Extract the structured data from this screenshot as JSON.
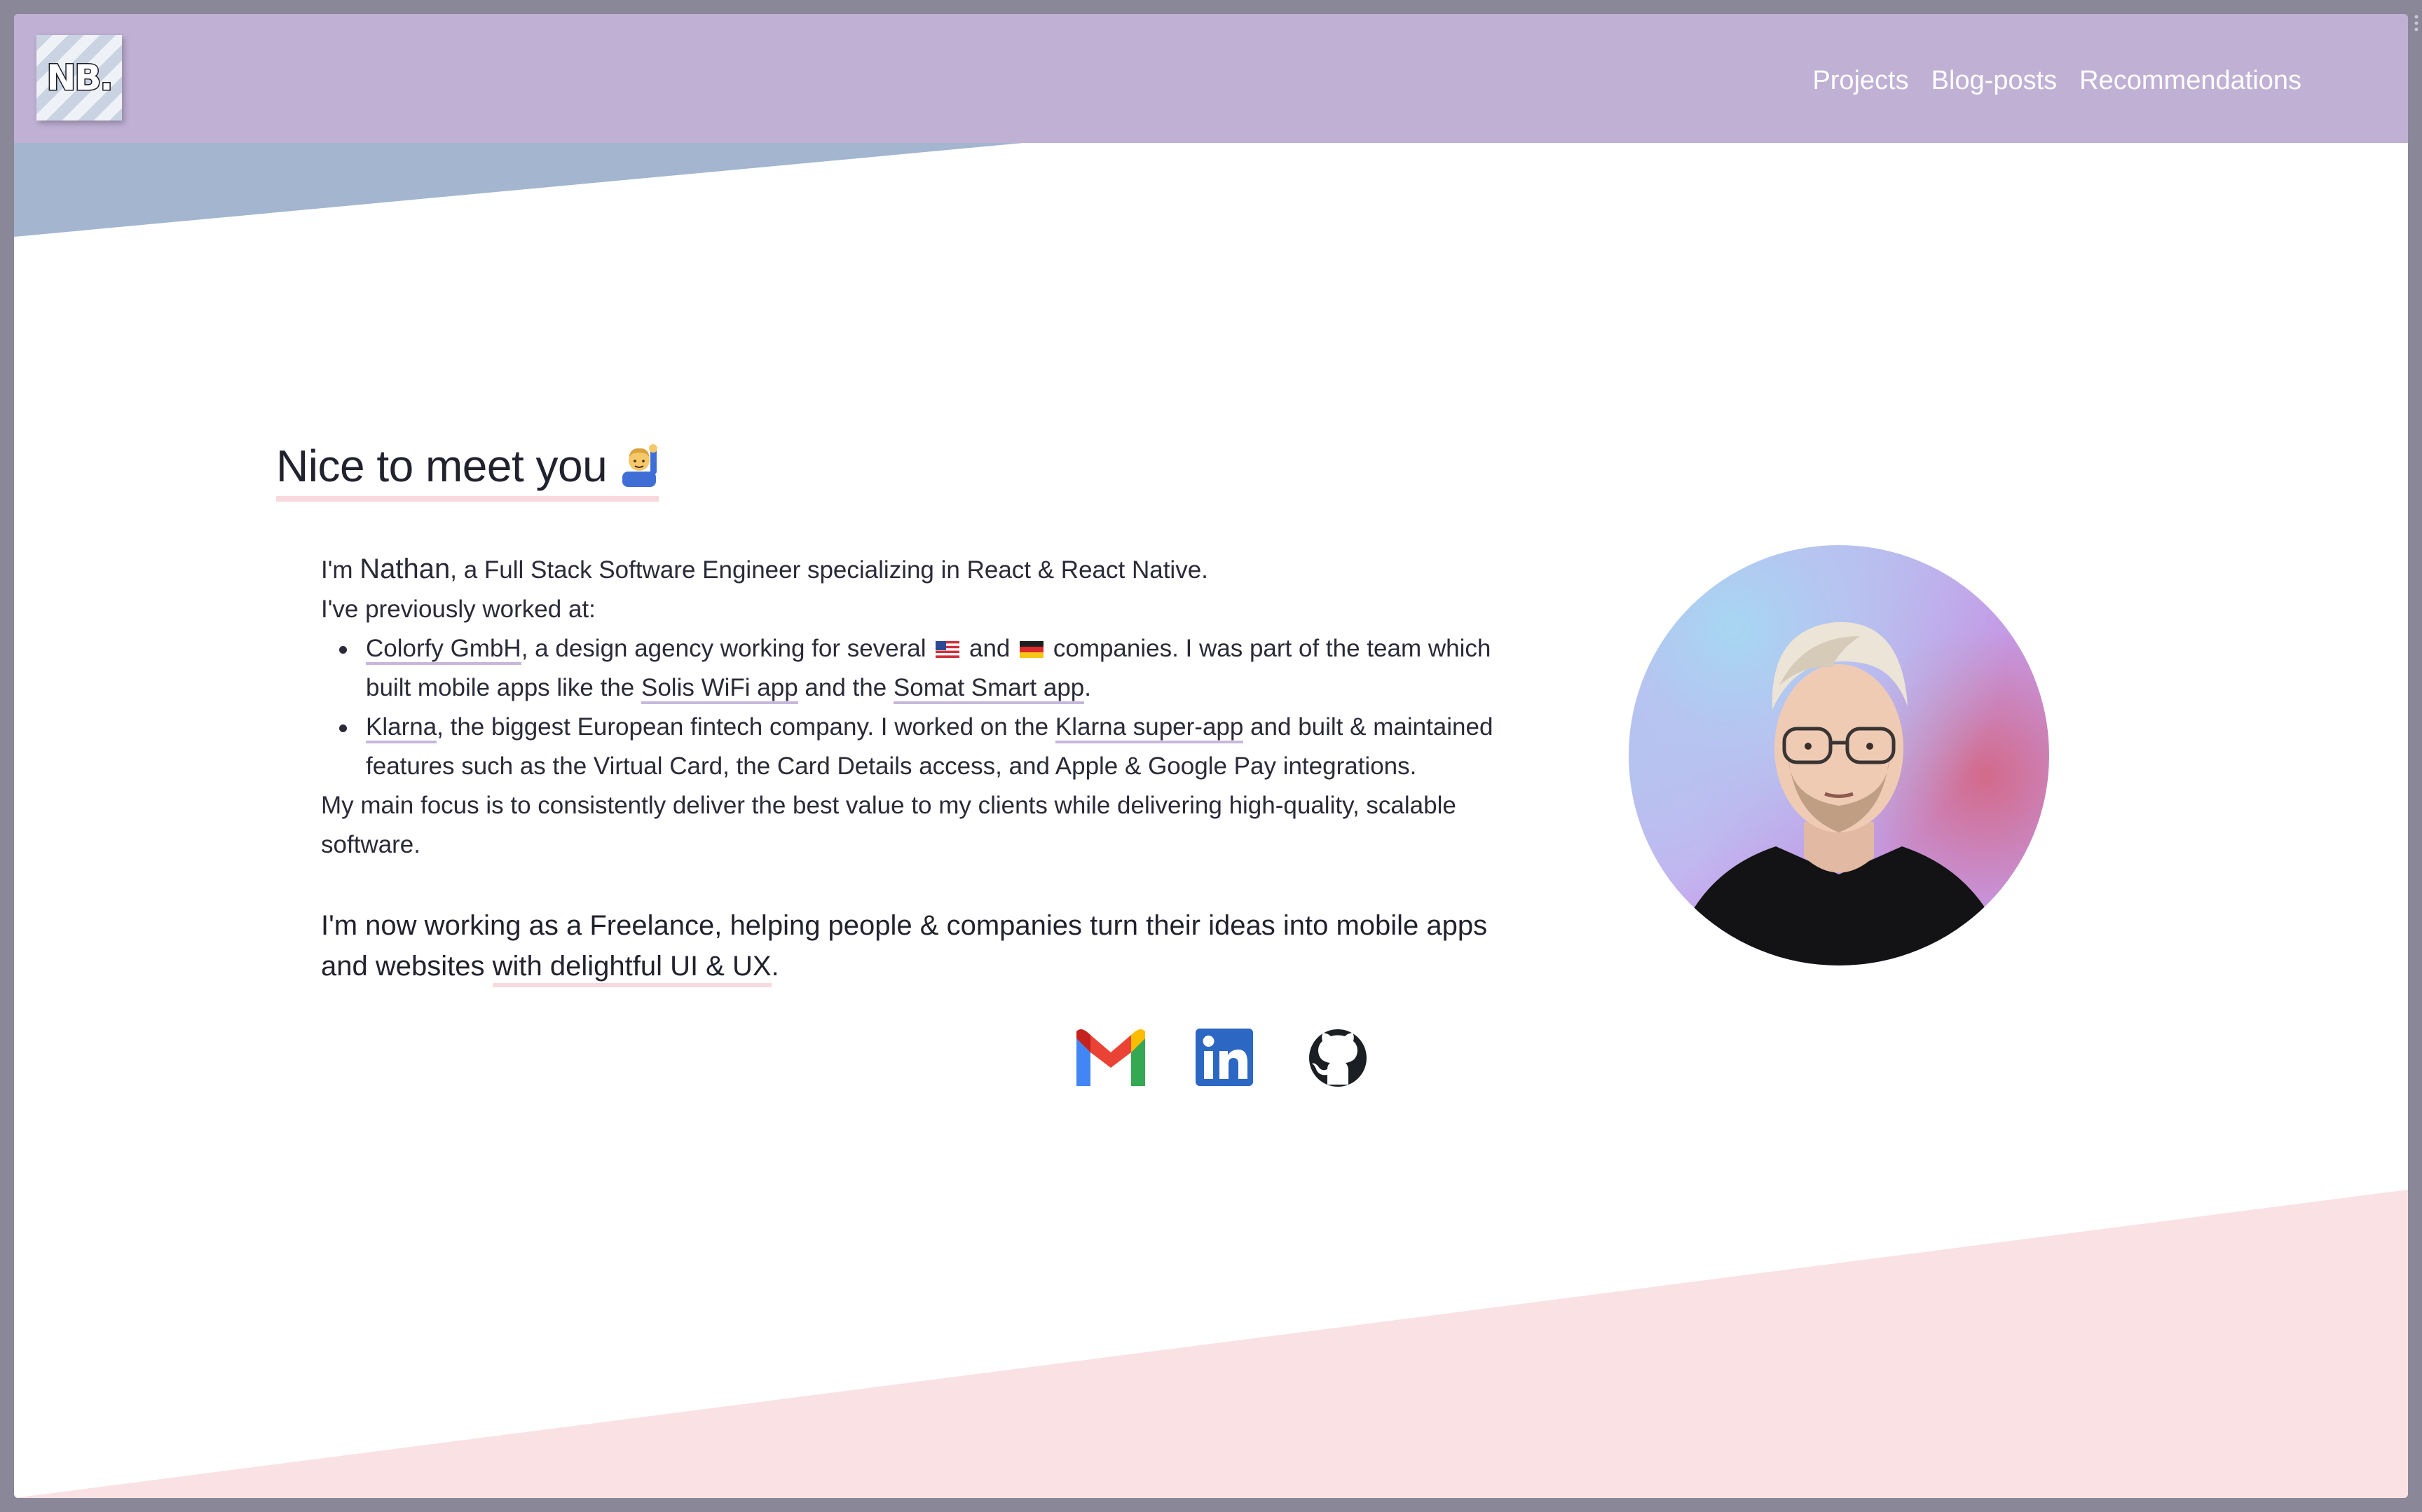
{
  "header": {
    "logo_text": "NB.",
    "nav": [
      "Projects",
      "Blog-posts",
      "Recommendations"
    ]
  },
  "main": {
    "title": "Nice to meet you",
    "title_emoji": "raising-hand-emoji",
    "intro": {
      "line1_prefix": "I'm ",
      "name": "Nathan",
      "line1_suffix": ", a Full Stack Software Engineer specializing in React & React Native.",
      "line2": "I've previously worked at:",
      "items": [
        {
          "company": "Colorfy GmbH",
          "text_a": ", a design agency working for several ",
          "text_and": " and ",
          "text_b": " companies. I was part of the team which built mobile apps like the ",
          "link_a": "Solis WiFi app",
          "text_c": " and the ",
          "link_b": "Somat Smart app",
          "text_d": "."
        },
        {
          "company": "Klarna",
          "text_a": ", the biggest European fintech company. I worked on the ",
          "link_a": "Klarna super-app",
          "text_b": " and built & maintained features such as the Virtual Card, the Card Details access, and Apple & Google Pay integrations."
        }
      ],
      "focus": "My main focus is to consistently deliver the best value to my clients while delivering high-quality, scalable software."
    },
    "freelance": {
      "text_a": "I'm now working as a Freelance, helping people & companies turn their ideas into mobile apps and websites ",
      "highlight": "with delightful UI & UX",
      "text_b": "."
    },
    "socials": [
      "gmail-icon",
      "linkedin-icon",
      "github-icon"
    ]
  },
  "colors": {
    "header_bg": "#bfb0d4",
    "top_wedge": "#a3b5cf",
    "bottom_wedge": "#f9e1e4",
    "underline_purple": "#c7b7dc",
    "underline_pink": "#f7d9de"
  }
}
